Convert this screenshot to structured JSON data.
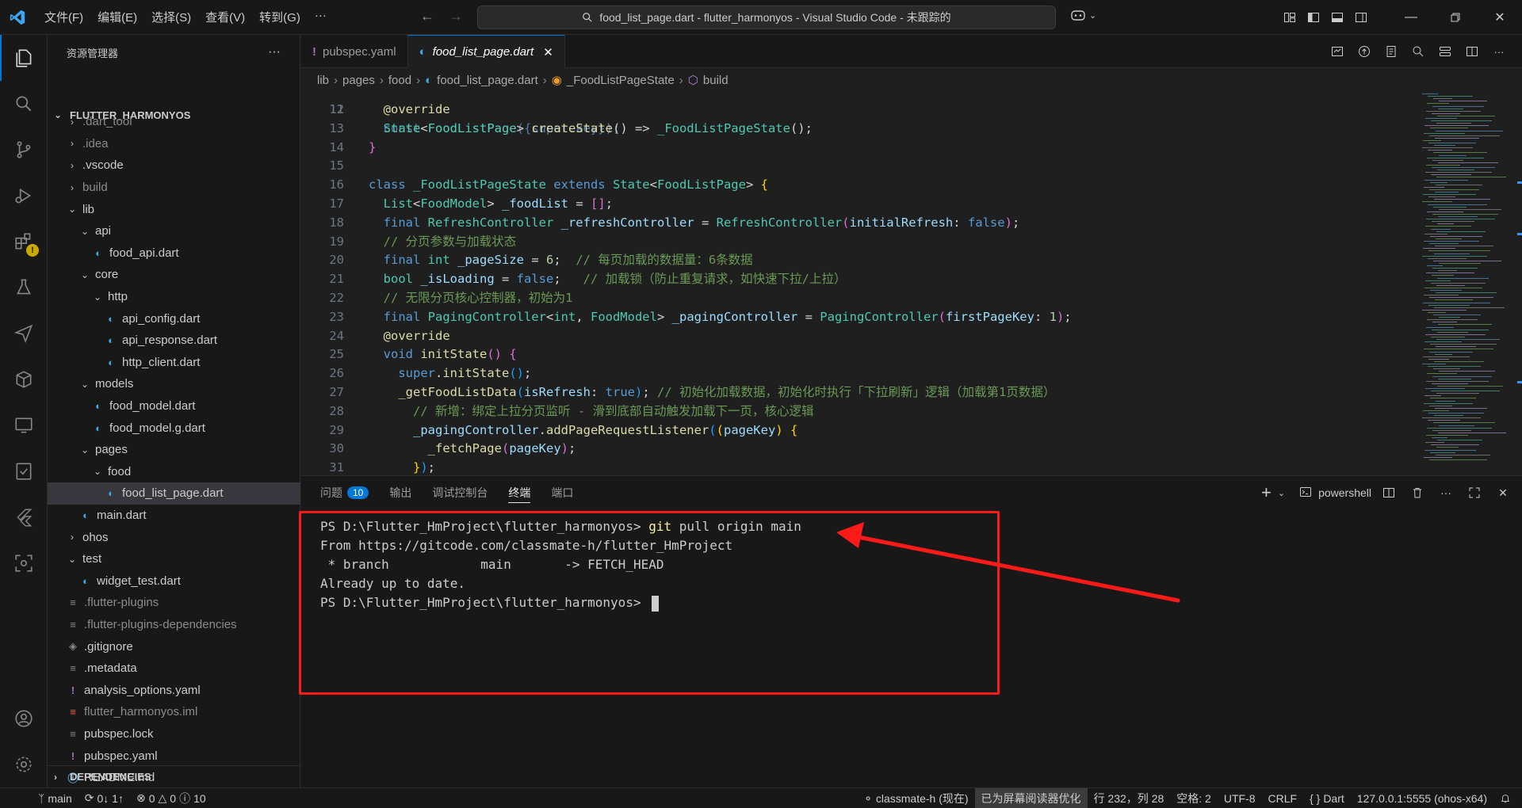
{
  "menu": [
    "文件(F)",
    "编辑(E)",
    "选择(S)",
    "查看(V)",
    "转到(G)",
    "···"
  ],
  "window_title": "food_list_page.dart - flutter_harmonyos - Visual Studio Code - 未跟踪的",
  "sidebar": {
    "header": "资源管理器",
    "section": "FLUTTER_HARMONYOS",
    "items": [
      {
        "label": ".dart_tool",
        "depth": 1,
        "kind": "folder",
        "open": false,
        "muted": true
      },
      {
        "label": ".idea",
        "depth": 1,
        "kind": "folder",
        "open": false,
        "muted": true
      },
      {
        "label": ".vscode",
        "depth": 1,
        "kind": "folder",
        "open": false
      },
      {
        "label": "build",
        "depth": 1,
        "kind": "folder",
        "open": false,
        "muted": true
      },
      {
        "label": "lib",
        "depth": 1,
        "kind": "folder",
        "open": true
      },
      {
        "label": "api",
        "depth": 2,
        "kind": "folder",
        "open": true
      },
      {
        "label": "food_api.dart",
        "depth": 3,
        "kind": "dart"
      },
      {
        "label": "core",
        "depth": 2,
        "kind": "folder",
        "open": true
      },
      {
        "label": "http",
        "depth": 3,
        "kind": "folder",
        "open": true
      },
      {
        "label": "api_config.dart",
        "depth": 4,
        "kind": "dart"
      },
      {
        "label": "api_response.dart",
        "depth": 4,
        "kind": "dart"
      },
      {
        "label": "http_client.dart",
        "depth": 4,
        "kind": "dart"
      },
      {
        "label": "models",
        "depth": 2,
        "kind": "folder",
        "open": true
      },
      {
        "label": "food_model.dart",
        "depth": 3,
        "kind": "dart"
      },
      {
        "label": "food_model.g.dart",
        "depth": 3,
        "kind": "dart"
      },
      {
        "label": "pages",
        "depth": 2,
        "kind": "folder",
        "open": true
      },
      {
        "label": "food",
        "depth": 3,
        "kind": "folder",
        "open": true
      },
      {
        "label": "food_list_page.dart",
        "depth": 4,
        "kind": "dart",
        "selected": true
      },
      {
        "label": "main.dart",
        "depth": 2,
        "kind": "dart"
      },
      {
        "label": "ohos",
        "depth": 1,
        "kind": "folder",
        "open": false
      },
      {
        "label": "test",
        "depth": 1,
        "kind": "folder",
        "open": true
      },
      {
        "label": "widget_test.dart",
        "depth": 2,
        "kind": "dart"
      },
      {
        "label": ".flutter-plugins",
        "depth": 1,
        "kind": "lines",
        "muted": true
      },
      {
        "label": ".flutter-plugins-dependencies",
        "depth": 1,
        "kind": "lines",
        "muted": true
      },
      {
        "label": ".gitignore",
        "depth": 1,
        "kind": "git"
      },
      {
        "label": ".metadata",
        "depth": 1,
        "kind": "lines"
      },
      {
        "label": "analysis_options.yaml",
        "depth": 1,
        "kind": "yaml"
      },
      {
        "label": "flutter_harmonyos.iml",
        "depth": 1,
        "kind": "iml",
        "muted": true
      },
      {
        "label": "pubspec.lock",
        "depth": 1,
        "kind": "lines"
      },
      {
        "label": "pubspec.yaml",
        "depth": 1,
        "kind": "yaml"
      },
      {
        "label": "README.md",
        "depth": 1,
        "kind": "info"
      }
    ],
    "footer": "DEPENDENCIES"
  },
  "tabs": [
    {
      "label": "pubspec.yaml",
      "icon": "yaml",
      "active": false
    },
    {
      "label": "food_list_page.dart",
      "icon": "dart",
      "active": true
    }
  ],
  "breadcrumb": [
    "lib",
    "pages",
    "food",
    "food_list_page.dart",
    "_FoodListPageState",
    "build"
  ],
  "code": {
    "partial_line": "  const FoodListPage({super.key});",
    "lines": [
      {
        "n": "12",
        "tokens": [
          [
            "an",
            "  @override"
          ]
        ]
      },
      {
        "n": "13",
        "tokens": [
          [
            "ty",
            "  State"
          ],
          [
            "pl",
            "<"
          ],
          [
            "ty",
            "FoodListPage"
          ],
          [
            "pl",
            "> "
          ],
          [
            "fn",
            "createState"
          ],
          [
            "pl",
            "() => "
          ],
          [
            "ty",
            "_FoodListPageState"
          ],
          [
            "pl",
            "();"
          ]
        ]
      },
      {
        "n": "14",
        "tokens": [
          [
            "br2",
            "}"
          ]
        ]
      },
      {
        "n": "15",
        "tokens": []
      },
      {
        "n": "16",
        "tokens": [
          [
            "kw",
            "class "
          ],
          [
            "ty",
            "_FoodListPageState "
          ],
          [
            "kw",
            "extends "
          ],
          [
            "ty",
            "State"
          ],
          [
            "pl",
            "<"
          ],
          [
            "ty",
            "FoodListPage"
          ],
          [
            "pl",
            "> "
          ],
          [
            "br1",
            "{"
          ]
        ]
      },
      {
        "n": "17",
        "tokens": [
          [
            "ty",
            "  List"
          ],
          [
            "pl",
            "<"
          ],
          [
            "ty",
            "FoodModel"
          ],
          [
            "pl",
            "> "
          ],
          [
            "va",
            "_foodList"
          ],
          [
            "pl",
            " = "
          ],
          [
            "br2",
            "[]"
          ],
          [
            "pl",
            ";"
          ]
        ]
      },
      {
        "n": "18",
        "tokens": [
          [
            "kw",
            "  final "
          ],
          [
            "ty",
            "RefreshController "
          ],
          [
            "va",
            "_refreshController"
          ],
          [
            "pl",
            " = "
          ],
          [
            "ty",
            "RefreshController"
          ],
          [
            "br2",
            "("
          ],
          [
            "va",
            "initialRefresh"
          ],
          [
            "pl",
            ": "
          ],
          [
            "kw",
            "false"
          ],
          [
            "br2",
            ")"
          ],
          [
            "pl",
            ";"
          ]
        ]
      },
      {
        "n": "19",
        "tokens": [
          [
            "cm",
            "  // 分页参数与加载状态"
          ]
        ]
      },
      {
        "n": "20",
        "tokens": [
          [
            "kw",
            "  final "
          ],
          [
            "ty",
            "int "
          ],
          [
            "va",
            "_pageSize"
          ],
          [
            "pl",
            " = "
          ],
          [
            "nu",
            "6"
          ],
          [
            "pl",
            ";  "
          ],
          [
            "cm",
            "// 每页加载的数据量：6条数据"
          ]
        ]
      },
      {
        "n": "21",
        "tokens": [
          [
            "ty",
            "  bool "
          ],
          [
            "va",
            "_isLoading"
          ],
          [
            "pl",
            " = "
          ],
          [
            "kw",
            "false"
          ],
          [
            "pl",
            ";   "
          ],
          [
            "cm",
            "// 加载锁（防止重复请求，如快速下拉/上拉）"
          ]
        ]
      },
      {
        "n": "22",
        "tokens": [
          [
            "cm",
            "  // 无限分页核心控制器，初始为1"
          ]
        ]
      },
      {
        "n": "23",
        "tokens": [
          [
            "kw",
            "  final "
          ],
          [
            "ty",
            "PagingController"
          ],
          [
            "pl",
            "<"
          ],
          [
            "ty",
            "int"
          ],
          [
            "pl",
            ", "
          ],
          [
            "ty",
            "FoodModel"
          ],
          [
            "pl",
            "> "
          ],
          [
            "va",
            "_pagingController"
          ],
          [
            "pl",
            " = "
          ],
          [
            "ty",
            "PagingController"
          ],
          [
            "br2",
            "("
          ],
          [
            "va",
            "firstPageKey"
          ],
          [
            "pl",
            ": "
          ],
          [
            "nu",
            "1"
          ],
          [
            "br2",
            ")"
          ],
          [
            "pl",
            ";"
          ]
        ]
      },
      {
        "n": "24",
        "tokens": [
          [
            "an",
            "  @override"
          ]
        ]
      },
      {
        "n": "25",
        "tokens": [
          [
            "kw",
            "  void "
          ],
          [
            "fn",
            "initState"
          ],
          [
            "br2",
            "()"
          ],
          [
            "pl",
            " "
          ],
          [
            "br2",
            "{"
          ]
        ]
      },
      {
        "n": "26",
        "tokens": [
          [
            "kw",
            "    super"
          ],
          [
            "pl",
            "."
          ],
          [
            "fn",
            "initState"
          ],
          [
            "br3",
            "()"
          ],
          [
            "pl",
            ";"
          ]
        ]
      },
      {
        "n": "27",
        "tokens": [
          [
            "fn",
            "    _getFoodListData"
          ],
          [
            "br3",
            "("
          ],
          [
            "va",
            "isRefresh"
          ],
          [
            "pl",
            ": "
          ],
          [
            "kw",
            "true"
          ],
          [
            "br3",
            ")"
          ],
          [
            "pl",
            "; "
          ],
          [
            "cm",
            "// 初始化加载数据，初始化时执行「下拉刷新」逻辑（加载第1页数据）"
          ]
        ]
      },
      {
        "n": "28",
        "tokens": [
          [
            "cm",
            "      // 新增：绑定上拉分页监听 - 滑到底部自动触发加载下一页，核心逻辑"
          ]
        ]
      },
      {
        "n": "29",
        "tokens": [
          [
            "va",
            "      _pagingController"
          ],
          [
            "pl",
            "."
          ],
          [
            "fn",
            "addPageRequestListener"
          ],
          [
            "br3",
            "("
          ],
          [
            "br1",
            "("
          ],
          [
            "va",
            "pageKey"
          ],
          [
            "br1",
            ")"
          ],
          [
            "pl",
            " "
          ],
          [
            "br1",
            "{"
          ]
        ]
      },
      {
        "n": "30",
        "tokens": [
          [
            "fn",
            "        _fetchPage"
          ],
          [
            "br2",
            "("
          ],
          [
            "va",
            "pageKey"
          ],
          [
            "br2",
            ")"
          ],
          [
            "pl",
            ";"
          ]
        ]
      },
      {
        "n": "31",
        "tokens": [
          [
            "br1",
            "      }"
          ],
          [
            "br3",
            ")"
          ],
          [
            "pl",
            ";"
          ]
        ]
      }
    ]
  },
  "panel": {
    "tabs": [
      {
        "label": "问题",
        "badge": "10"
      },
      {
        "label": "输出"
      },
      {
        "label": "调试控制台"
      },
      {
        "label": "终端",
        "active": true
      },
      {
        "label": "端口"
      }
    ],
    "shell": "powershell",
    "terminal": {
      "prompt": "PS D:\\Flutter_HmProject\\flutter_harmonyos> ",
      "command": "git",
      "args": " pull origin main",
      "output": [
        "From https://gitcode.com/classmate-h/flutter_HmProject",
        " * branch            main       -> FETCH_HEAD",
        "Already up to date."
      ],
      "prompt2": "PS D:\\Flutter_HmProject\\flutter_harmonyos> "
    }
  },
  "status": {
    "branch": "main",
    "sync": "0↓ 1↑",
    "errors": "0",
    "warnings": "0",
    "info": "10",
    "author": "classmate-h (现在)",
    "screen_reader": "已为屏幕阅读器优化",
    "position": "行 232，列 28",
    "spaces": "空格: 2",
    "encoding": "UTF-8",
    "eol": "CRLF",
    "language": "Dart",
    "server": "127.0.0.1:5555 (ohos-x64)"
  },
  "colors": {
    "accent": "#0078d4",
    "annotation_red": "#ff1a1a"
  }
}
